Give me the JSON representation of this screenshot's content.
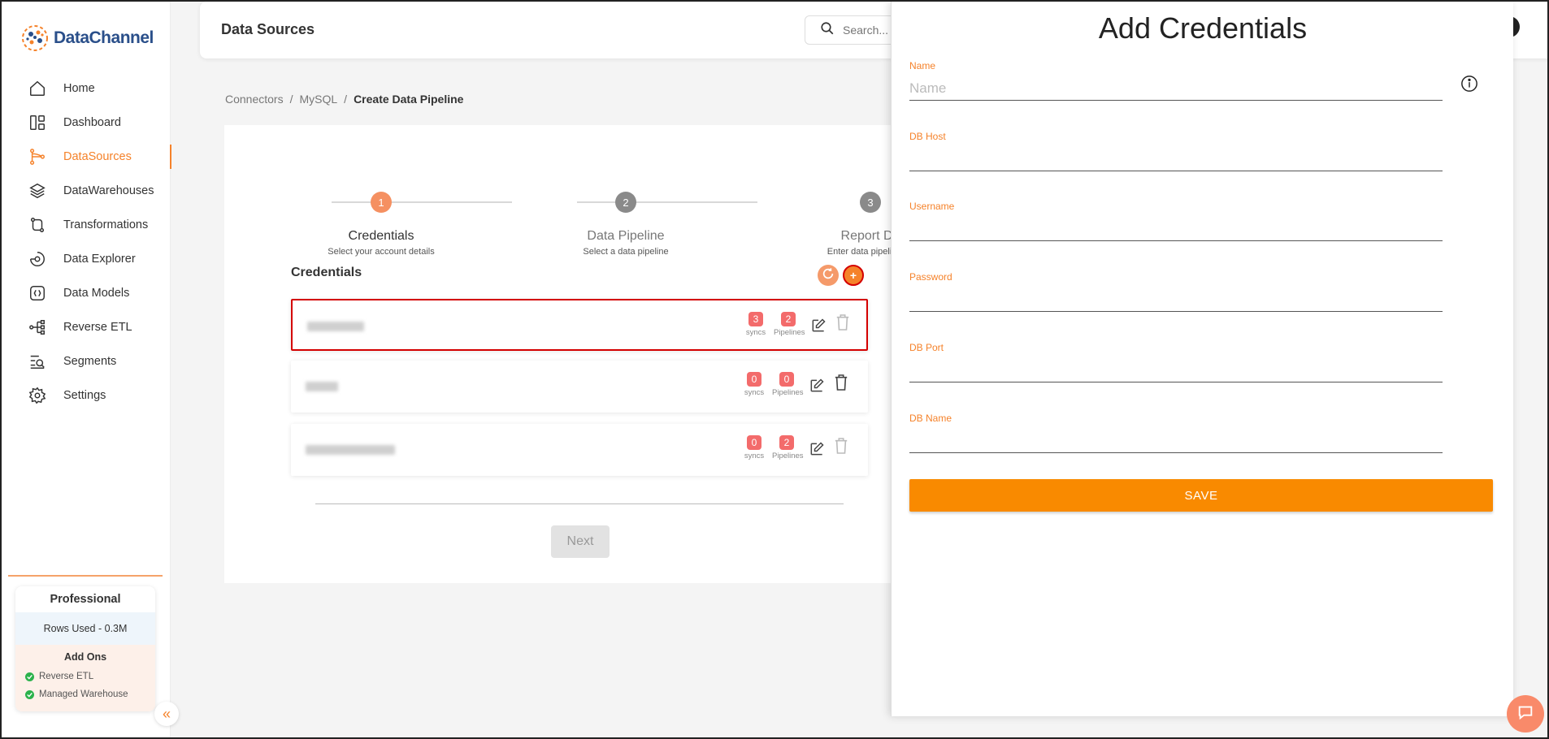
{
  "app": {
    "brand_name": "DataChannel",
    "page_title": "Data Sources"
  },
  "search": {
    "placeholder": "Search..."
  },
  "sidebar": {
    "items": [
      {
        "label": "Home",
        "icon": "home-icon"
      },
      {
        "label": "Dashboard",
        "icon": "dashboard-icon"
      },
      {
        "label": "DataSources",
        "icon": "datasources-icon",
        "active": true
      },
      {
        "label": "DataWarehouses",
        "icon": "datawarehouses-icon"
      },
      {
        "label": "Transformations",
        "icon": "transformations-icon"
      },
      {
        "label": "Data Explorer",
        "icon": "data-explorer-icon"
      },
      {
        "label": "Data Models",
        "icon": "data-models-icon"
      },
      {
        "label": "Reverse ETL",
        "icon": "reverse-etl-icon"
      },
      {
        "label": "Segments",
        "icon": "segments-icon"
      },
      {
        "label": "Settings",
        "icon": "settings-icon"
      }
    ],
    "plan": {
      "title": "Professional",
      "rows_used": "Rows Used - 0.3M",
      "addons_title": "Add Ons",
      "addons": [
        "Reverse ETL",
        "Managed Warehouse"
      ]
    }
  },
  "breadcrumb": {
    "items": [
      "Connectors",
      "MySQL",
      "Create Data Pipeline"
    ],
    "separator": "/"
  },
  "stepper": {
    "steps": [
      {
        "number": "1",
        "label": "Credentials",
        "sub": "Select your account details",
        "active": true
      },
      {
        "number": "2",
        "label": "Data Pipeline",
        "sub": "Select a data pipeline"
      },
      {
        "number": "3",
        "label": "Report De",
        "sub": "Enter data pipeline co"
      }
    ]
  },
  "credentials": {
    "title": "Credentials",
    "syncs_label": "syncs",
    "pipelines_label": "Pipelines",
    "rows": [
      {
        "syncs": "3",
        "pipelines": "2",
        "selected": true
      },
      {
        "syncs": "0",
        "pipelines": "0",
        "selected": false
      },
      {
        "syncs": "0",
        "pipelines": "2",
        "selected": false
      }
    ]
  },
  "next_label": "Next",
  "drawer": {
    "title": "Add Credentials",
    "fields": [
      {
        "label": "Name",
        "placeholder": "Name",
        "value": ""
      },
      {
        "label": "DB Host",
        "placeholder": "",
        "value": ""
      },
      {
        "label": "Username",
        "placeholder": "",
        "value": ""
      },
      {
        "label": "Password",
        "placeholder": "",
        "value": ""
      },
      {
        "label": "DB Port",
        "placeholder": "",
        "value": ""
      },
      {
        "label": "DB Name",
        "placeholder": "",
        "value": ""
      }
    ],
    "save_label": "SAVE"
  },
  "colors": {
    "accent": "#f5822a",
    "save_button": "#f98a00",
    "badge": "#f36b6b",
    "selected_border": "#d40000",
    "step_active": "#f59061",
    "step_inactive": "#8a8a8a"
  }
}
